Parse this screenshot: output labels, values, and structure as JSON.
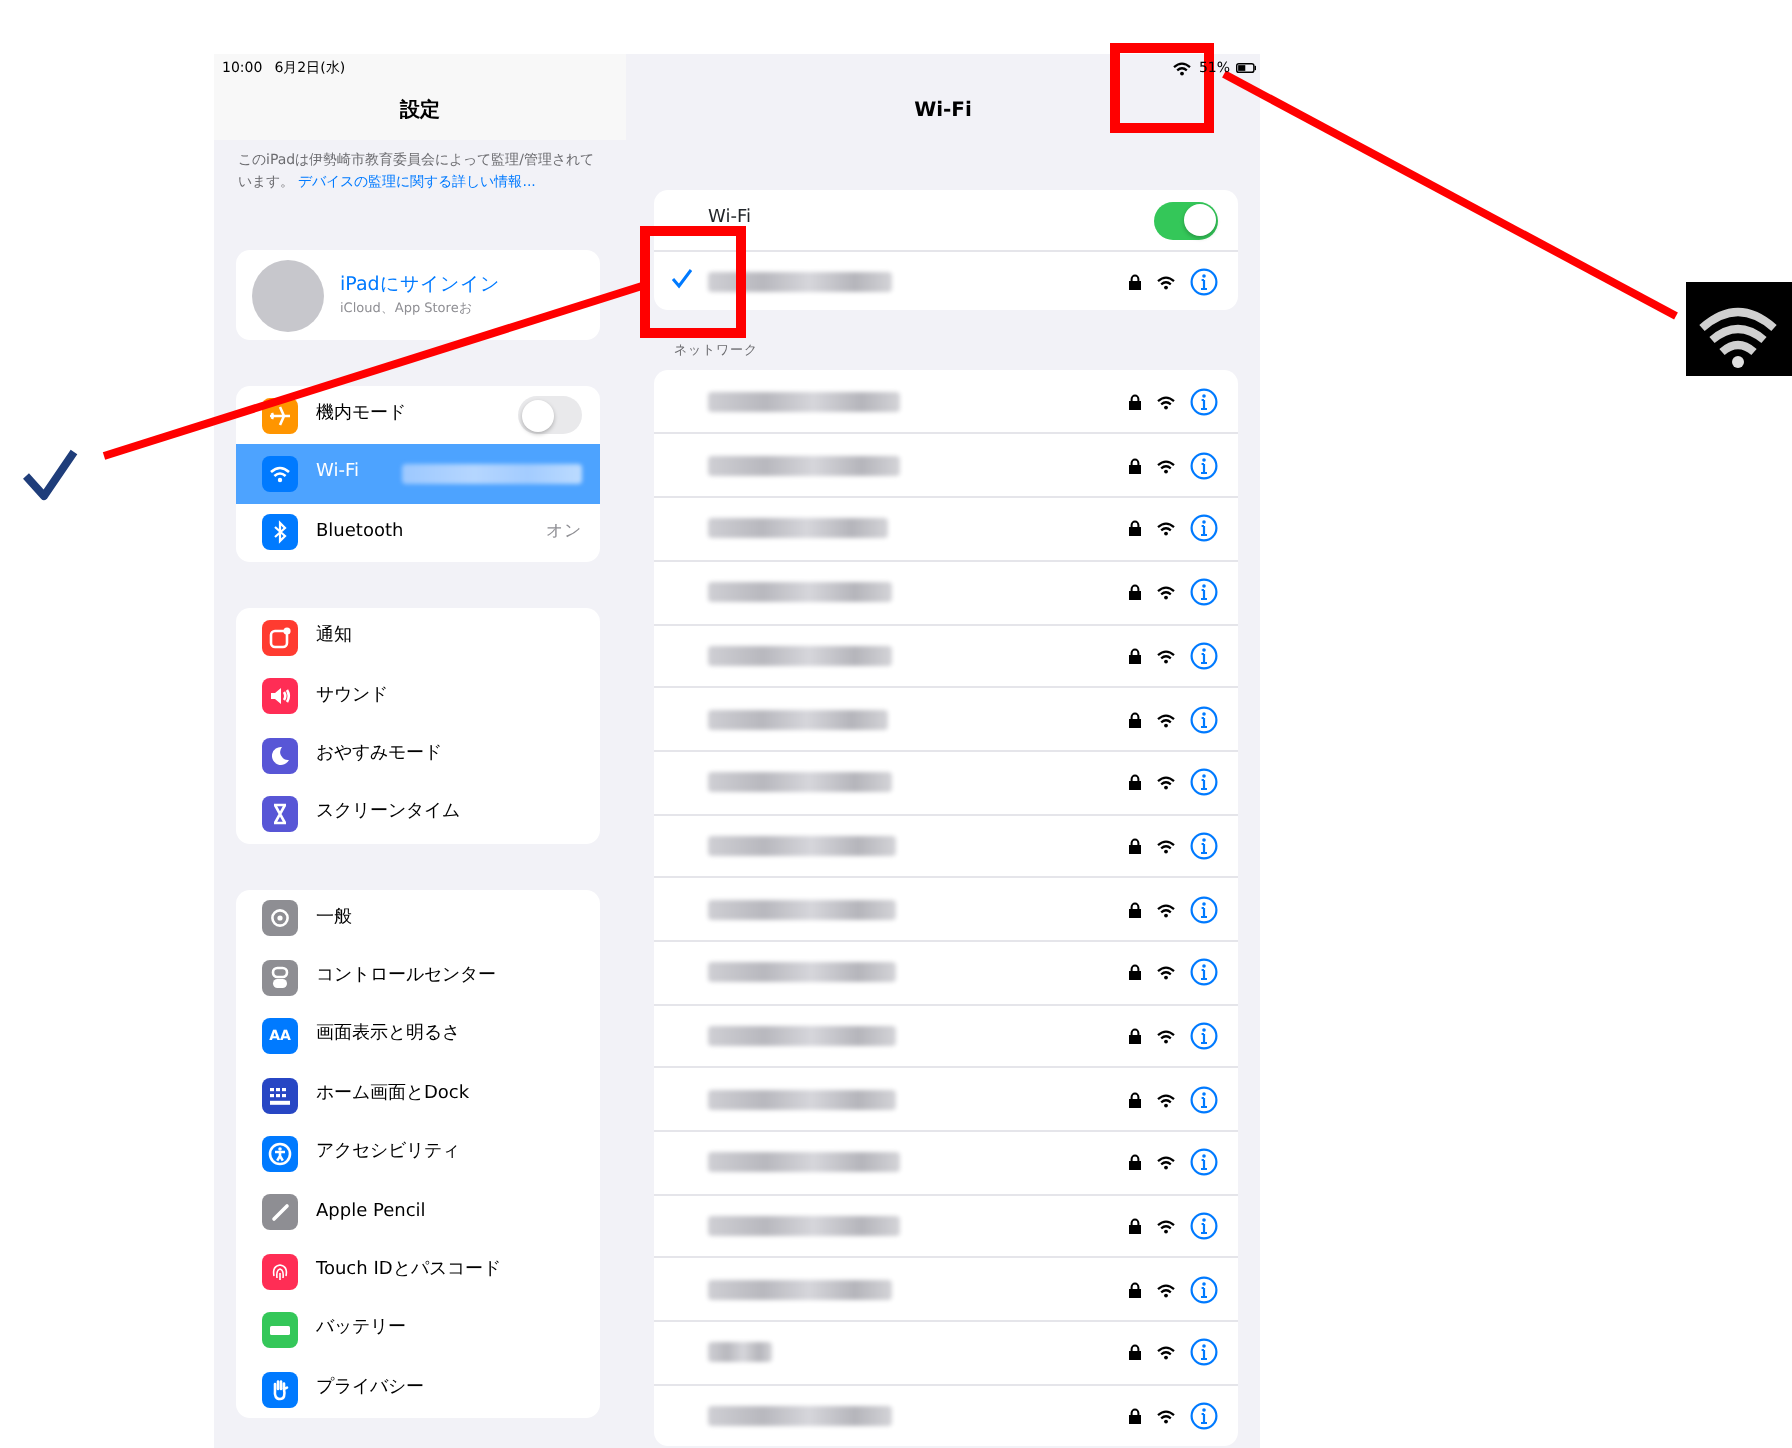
{
  "status_bar": {
    "time": "10:00",
    "date": "6月2日(水)",
    "battery": "51%"
  },
  "sidebar": {
    "title": "設定",
    "notice": {
      "text": "このiPadは伊勢崎市教育委員会によって監理/管理されています。",
      "link": "デバイスの監理に関する詳しい情報..."
    },
    "account": {
      "title": "iPadにサインイン",
      "subtitle": "iCloud、App Storeお"
    },
    "groups": [
      [
        {
          "label": "機内モード",
          "color": "#ff9500",
          "kind": "toggle",
          "on": false,
          "selected": false
        },
        {
          "label": "Wi-Fi",
          "color": "#007aff",
          "kind": "hidden_value",
          "selected": true
        },
        {
          "label": "Bluetooth",
          "color": "#007aff",
          "kind": "value",
          "value": "オン",
          "selected": false
        }
      ],
      [
        {
          "label": "通知",
          "color": "#ff3b30",
          "kind": "plain",
          "selected": false
        },
        {
          "label": "サウンド",
          "color": "#ff2d55",
          "kind": "plain",
          "selected": false
        },
        {
          "label": "おやすみモード",
          "color": "#5856d6",
          "kind": "plain",
          "selected": false
        },
        {
          "label": "スクリーンタイム",
          "color": "#5856d6",
          "kind": "plain",
          "selected": false
        }
      ],
      [
        {
          "label": "一般",
          "color": "#8e8e93",
          "kind": "plain",
          "selected": false
        },
        {
          "label": "コントロールセンター",
          "color": "#8e8e93",
          "kind": "plain",
          "selected": false
        },
        {
          "label": "画面表示と明るさ",
          "color": "#007aff",
          "kind": "plain",
          "icon_text": "AA",
          "selected": false
        },
        {
          "label": "ホーム画面とDock",
          "color": "#2746c4",
          "kind": "plain",
          "selected": false
        },
        {
          "label": "アクセシビリティ",
          "color": "#007aff",
          "kind": "plain",
          "selected": false
        },
        {
          "label": "Apple Pencil",
          "color": "#8e8e93",
          "kind": "plain",
          "selected": false
        },
        {
          "label": "Touch IDとパスコード",
          "color": "#ff2d55",
          "kind": "plain",
          "selected": false
        },
        {
          "label": "バッテリー",
          "color": "#34c759",
          "kind": "plain",
          "selected": false
        },
        {
          "label": "プライバシー",
          "color": "#007aff",
          "kind": "plain",
          "selected": false
        }
      ]
    ]
  },
  "detail": {
    "title": "Wi-Fi",
    "wifi": {
      "label": "Wi-Fi",
      "on": true
    },
    "connected": {
      "selected": true,
      "locked": true
    },
    "section_label": "ネットワーク",
    "networks": [
      {
        "locked": true
      },
      {
        "locked": true
      },
      {
        "locked": true
      },
      {
        "locked": true
      },
      {
        "locked": true
      },
      {
        "locked": true
      },
      {
        "locked": true
      },
      {
        "locked": true
      },
      {
        "locked": true
      },
      {
        "locked": true
      },
      {
        "locked": true
      },
      {
        "locked": true
      },
      {
        "locked": true
      },
      {
        "locked": true
      },
      {
        "locked": true
      },
      {
        "locked": true
      },
      {
        "locked": true
      }
    ]
  }
}
